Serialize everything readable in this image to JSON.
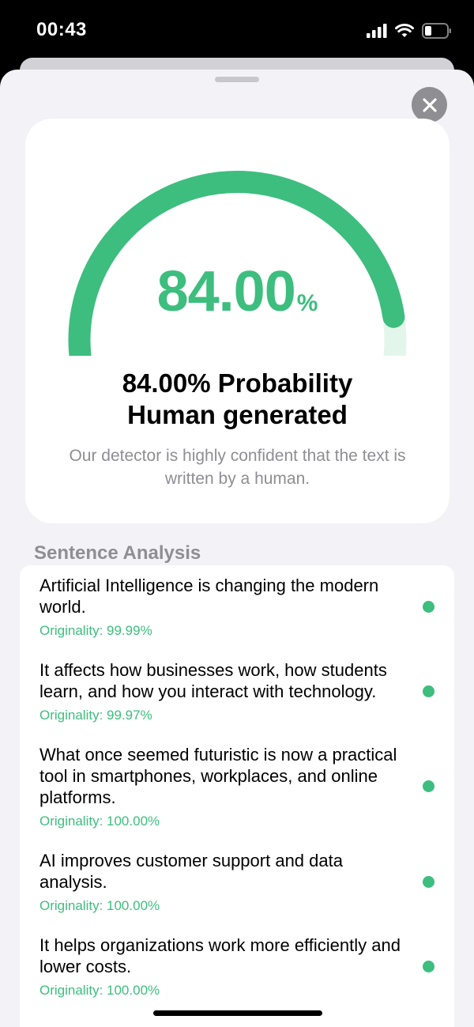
{
  "status_bar": {
    "time": "00:43",
    "icons": [
      "signal-icon",
      "wifi-icon",
      "battery-icon"
    ]
  },
  "close_button": {
    "icon": "close-icon"
  },
  "result": {
    "score": "84.00",
    "unit": "%",
    "fraction": 0.84,
    "title_line1": "84.00% Probability",
    "title_line2": "Human generated",
    "description": "Our detector is highly confident that the text is written by a human.",
    "accent_color": "#3dbe7e",
    "track_color": "#e3f6ec"
  },
  "analysis": {
    "title": "Sentence Analysis",
    "items": [
      {
        "sentence": "Artificial Intelligence is changing the modern world.",
        "originality": "Originality: 99.99%"
      },
      {
        "sentence": "It affects how businesses work, how students learn, and how you interact with technology.",
        "originality": "Originality: 99.97%"
      },
      {
        "sentence": "What once seemed futuristic is now a practical tool in smartphones, workplaces, and online platforms.",
        "originality": "Originality: 100.00%"
      },
      {
        "sentence": "AI improves customer support and data analysis.",
        "originality": "Originality: 100.00%"
      },
      {
        "sentence": "It helps organizations work more efficiently and lower costs.",
        "originality": "Originality: 100.00%"
      }
    ]
  }
}
